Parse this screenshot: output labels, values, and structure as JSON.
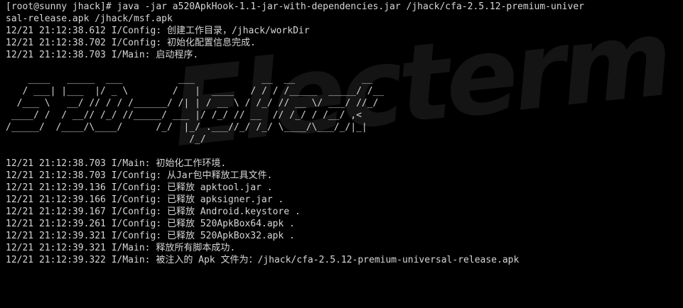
{
  "terminal": {
    "command_lines": [
      "[root@sunny jhack]# java -jar a520ApkHook-1.1-jar-with-dependencies.jar /jhack/cfa-2.5.12-premium-univer",
      "sal-release.apk /jhack/msf.apk"
    ],
    "log_top": [
      "12/21 21:12:38.612 I/Config: 创建工作目录，/jhack/workDir",
      "12/21 21:12:38.702 I/Config: 初始化配置信息完成.",
      "12/21 21:12:38.703 I/Main: 启动程序."
    ],
    "banner": "\n    ____   _____  ___          ___            __  __            __     \n   / ___| |___  |/ _ \\        /   |  ____   / / / /_____  _____/ /__   \n  /___ \\   __/ // / / /______/ /| | / __ \\ / /_/ // __ \\/ ___/ //_/   \n ____/ /  / __// /_/ //_____/ ___ |/ /_/ // __  // /_/ / /__/ ,<      \n/_____/  /____/\\____/      /_/  |_/ .___//_/ /_/ \\____/\\___/_/|_|     \n                                 /_/                                  \n",
    "log_bottom": [
      "12/21 21:12:38.703 I/Main: 初始化工作环境.",
      "12/21 21:12:38.703 I/Config: 从Jar包中释放工具文件.",
      "12/21 21:12:39.136 I/Config: 已释放 apktool.jar .",
      "12/21 21:12:39.166 I/Config: 已释放 apksigner.jar .",
      "12/21 21:12:39.167 I/Config: 已释放 Android.keystore .",
      "12/21 21:12:39.261 I/Config: 已释放 520ApkBox64.apk .",
      "12/21 21:12:39.321 I/Config: 已释放 520ApkBox32.apk .",
      "12/21 21:12:39.321 I/Main: 释放所有脚本成功.",
      "12/21 21:12:39.322 I/Main: 被注入的 Apk 文件为：/jhack/cfa-2.5.12-premium-universal-release.apk"
    ],
    "watermark_text": "Electerm"
  },
  "colors": {
    "background": "#000000",
    "foreground": "#d6d6d6"
  }
}
